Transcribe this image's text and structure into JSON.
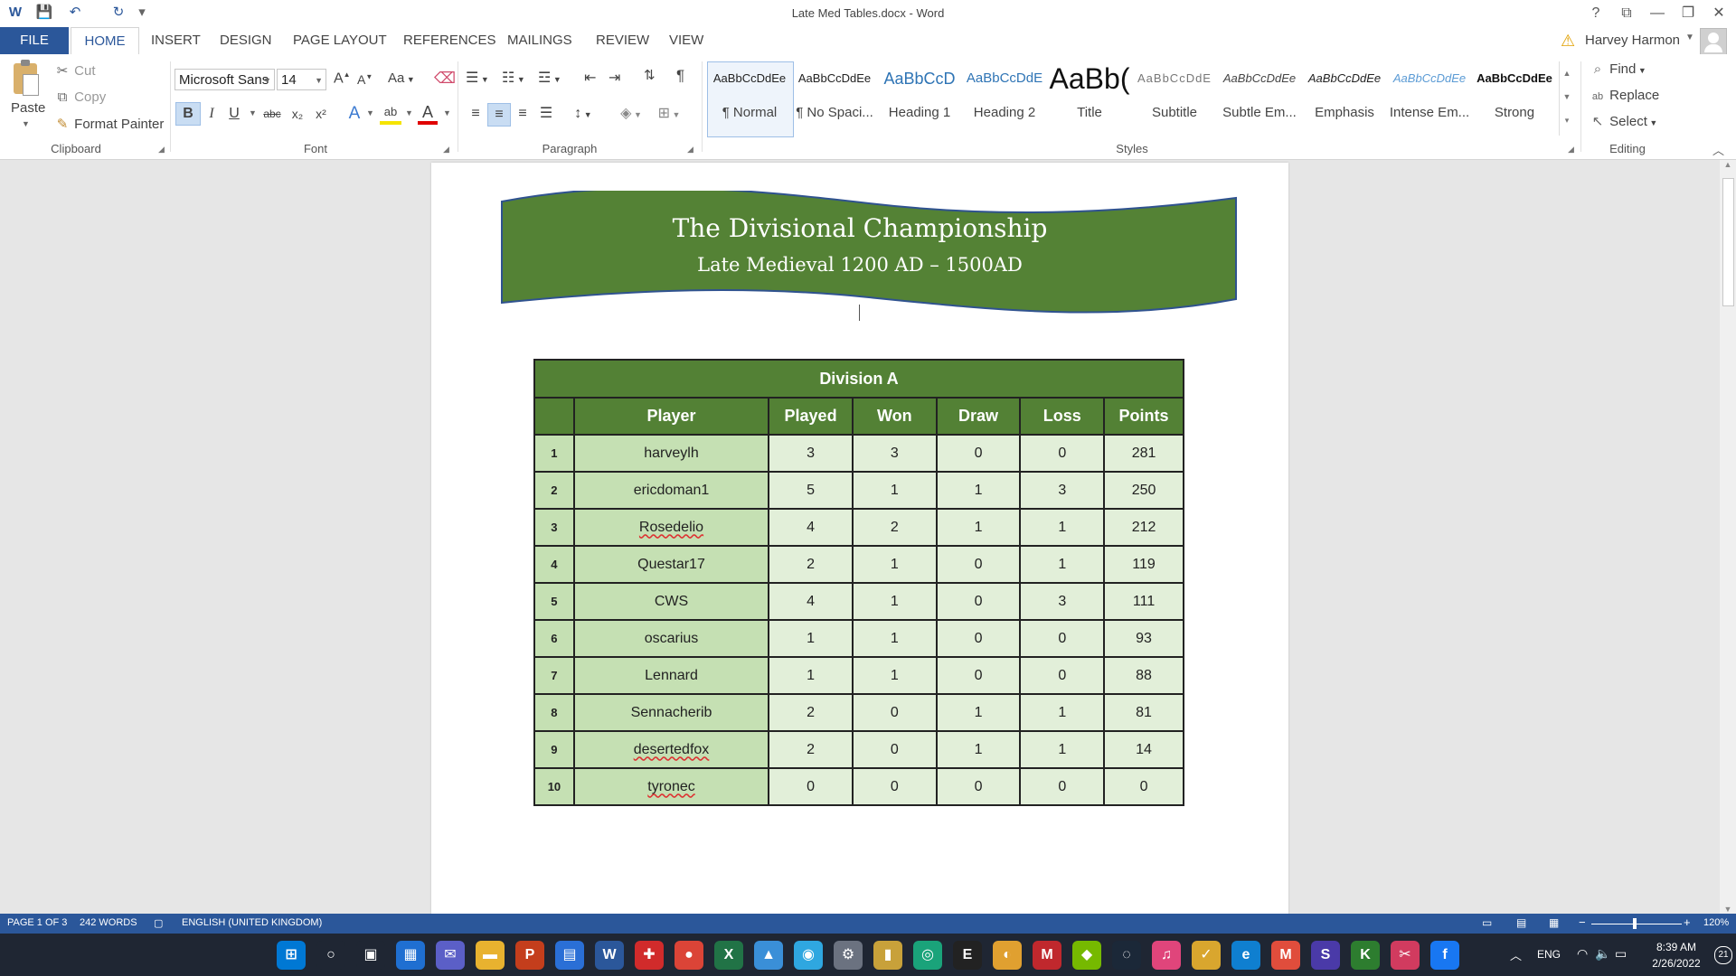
{
  "window": {
    "title": "Late Med Tables.docx - Word",
    "help": "?",
    "restore_ribbon": "⧉",
    "minimize": "—",
    "maximize": "❐",
    "close": "✕"
  },
  "qat": {
    "word_logo": "W",
    "save": "💾",
    "undo": "↶",
    "redo": "↻",
    "customize": "▾"
  },
  "tabs": {
    "file": "FILE",
    "home": "HOME",
    "insert": "INSERT",
    "design": "DESIGN",
    "page_layout": "PAGE LAYOUT",
    "references": "REFERENCES",
    "mailings": "MAILINGS",
    "review": "REVIEW",
    "view": "VIEW"
  },
  "account": {
    "warning": "⚠",
    "user": "Harvey Harmon"
  },
  "clipboard": {
    "paste": "Paste",
    "cut": "Cut",
    "copy": "Copy",
    "format_painter": "Format Painter",
    "label": "Clipboard"
  },
  "font": {
    "name": "Microsoft Sans",
    "size": "14",
    "label": "Font",
    "grow": "A",
    "shrink": "A",
    "case": "Aa",
    "bold": "B",
    "italic": "I",
    "underline": "U",
    "strike": "abc",
    "subscript": "x₂",
    "superscript": "x²",
    "text_effects": "A",
    "highlight": "ab",
    "font_color": "A"
  },
  "paragraph": {
    "label": "Paragraph",
    "pilcrow": "¶"
  },
  "styles": {
    "label": "Styles",
    "items": [
      {
        "preview": "AaBbCcDdEe",
        "name": "¶ Normal"
      },
      {
        "preview": "AaBbCcDdEe",
        "name": "¶ No Spaci..."
      },
      {
        "preview": "AaBbCcD",
        "name": "Heading 1"
      },
      {
        "preview": "AaBbCcDdE",
        "name": "Heading 2"
      },
      {
        "preview": "AaBb(",
        "name": "Title"
      },
      {
        "preview": "AaBbCcDdE",
        "name": "Subtitle"
      },
      {
        "preview": "AaBbCcDdEe",
        "name": "Subtle Em..."
      },
      {
        "preview": "AaBbCcDdEe",
        "name": "Emphasis"
      },
      {
        "preview": "AaBbCcDdEe",
        "name": "Intense Em..."
      },
      {
        "preview": "AaBbCcDdEe",
        "name": "Strong"
      }
    ],
    "colors": {
      "heading": "#2e74b5",
      "intense": "#5b9bd5"
    }
  },
  "editing": {
    "find": "Find",
    "replace": "Replace",
    "select": "Select",
    "label": "Editing"
  },
  "document": {
    "banner_title": "The Divisional Championship",
    "banner_subtitle": "Late Medieval 1200 AD – 1500AD",
    "banner_color": "#548235",
    "division_title": "Division A",
    "columns": [
      "Player",
      "Played",
      "Won",
      "Draw",
      "Loss",
      "Points"
    ],
    "rows": [
      {
        "pos": "1",
        "player": "harveylh",
        "played": "3",
        "won": "3",
        "draw": "0",
        "loss": "0",
        "points": "281"
      },
      {
        "pos": "2",
        "player": "ericdoman1",
        "played": "5",
        "won": "1",
        "draw": "1",
        "loss": "3",
        "points": "250"
      },
      {
        "pos": "3",
        "player": "Rosedelio",
        "played": "4",
        "won": "2",
        "draw": "1",
        "loss": "1",
        "points": "212"
      },
      {
        "pos": "4",
        "player": "Questar17",
        "played": "2",
        "won": "1",
        "draw": "0",
        "loss": "1",
        "points": "119"
      },
      {
        "pos": "5",
        "player": "CWS",
        "played": "4",
        "won": "1",
        "draw": "0",
        "loss": "3",
        "points": "111"
      },
      {
        "pos": "6",
        "player": "oscarius",
        "played": "1",
        "won": "1",
        "draw": "0",
        "loss": "0",
        "points": "93"
      },
      {
        "pos": "7",
        "player": "Lennard",
        "played": "1",
        "won": "1",
        "draw": "0",
        "loss": "0",
        "points": "88"
      },
      {
        "pos": "8",
        "player": "Sennacherib",
        "played": "2",
        "won": "0",
        "draw": "1",
        "loss": "1",
        "points": "81"
      },
      {
        "pos": "9",
        "player": "desertedfox",
        "played": "2",
        "won": "0",
        "draw": "1",
        "loss": "1",
        "points": "14"
      },
      {
        "pos": "10",
        "player": "tyronec",
        "played": "0",
        "won": "0",
        "draw": "0",
        "loss": "0",
        "points": "0"
      }
    ]
  },
  "status": {
    "page": "PAGE 1 OF 3",
    "words": "242 WORDS",
    "language": "ENGLISH (UNITED KINGDOM)",
    "zoom": "120%",
    "zoom_minus": "−",
    "zoom_plus": "+"
  },
  "taskbar": {
    "time": "8:39 AM",
    "date": "2/26/2022",
    "lang": "ENG",
    "notif_count": "21",
    "apps": [
      {
        "name": "start-icon",
        "glyph": "⊞",
        "color": "#0078d4"
      },
      {
        "name": "search-icon",
        "glyph": "○",
        "color": "#1f2633"
      },
      {
        "name": "task-view-icon",
        "glyph": "▣",
        "color": "#1f2633"
      },
      {
        "name": "widgets-icon",
        "glyph": "▦",
        "color": "#1f6fd1"
      },
      {
        "name": "teams-chat-icon",
        "glyph": "✉",
        "color": "#5b5fc7"
      },
      {
        "name": "file-explorer-icon",
        "glyph": "▬",
        "color": "#e8b22f"
      },
      {
        "name": "powerpoint-icon",
        "glyph": "P",
        "color": "#c43e1c"
      },
      {
        "name": "store-icon",
        "glyph": "▤",
        "color": "#2a6fd6"
      },
      {
        "name": "word-icon",
        "glyph": "W",
        "color": "#2b579a"
      },
      {
        "name": "gift-icon",
        "glyph": "✚",
        "color": "#d12b2b"
      },
      {
        "name": "chrome-icon",
        "glyph": "●",
        "color": "#db4437"
      },
      {
        "name": "excel-icon",
        "glyph": "X",
        "color": "#217346"
      },
      {
        "name": "photos-icon",
        "glyph": "▲",
        "color": "#3a8fd8"
      },
      {
        "name": "maps-icon",
        "glyph": "◉",
        "color": "#2fa7e0"
      },
      {
        "name": "settings-icon",
        "glyph": "⚙",
        "color": "#6b7280"
      },
      {
        "name": "notes-icon",
        "glyph": "▮",
        "color": "#c8a13a"
      },
      {
        "name": "app-icon",
        "glyph": "◎",
        "color": "#1aa37a"
      },
      {
        "name": "epic-games-icon",
        "glyph": "E",
        "color": "#222222"
      },
      {
        "name": "app2-icon",
        "glyph": "◐",
        "color": "#e0a030"
      },
      {
        "name": "m-app-icon",
        "glyph": "M",
        "color": "#c0282d"
      },
      {
        "name": "nvidia-icon",
        "glyph": "◆",
        "color": "#76b900"
      },
      {
        "name": "steam-icon",
        "glyph": "◌",
        "color": "#1b2838"
      },
      {
        "name": "music-icon",
        "glyph": "♫",
        "color": "#e0457b"
      },
      {
        "name": "checkmark-app-icon",
        "glyph": "✓",
        "color": "#d9a62e"
      },
      {
        "name": "edge-icon",
        "glyph": "e",
        "color": "#0f7fd0"
      },
      {
        "name": "gmail-icon",
        "glyph": "M",
        "color": "#e04d3c"
      },
      {
        "name": "s-app-icon",
        "glyph": "S",
        "color": "#4a3aa8"
      },
      {
        "name": "k-app-icon",
        "glyph": "K",
        "color": "#2d7d2f"
      },
      {
        "name": "snip-icon",
        "glyph": "✂",
        "color": "#d13b5f"
      },
      {
        "name": "facebook-icon",
        "glyph": "f",
        "color": "#1877f2"
      }
    ]
  }
}
